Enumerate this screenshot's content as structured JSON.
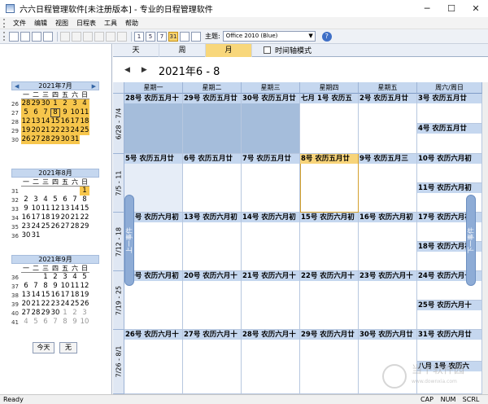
{
  "window": {
    "title": "六六日程管理软件[未注册版本] - 专业的日程管理软件",
    "minimize": "─",
    "maximize": "☐",
    "close": "✕"
  },
  "menu": [
    "文件",
    "编辑",
    "视图",
    "日程表",
    "工具",
    "帮助"
  ],
  "toolbar": {
    "buttons": [
      "new-icon",
      "open-icon",
      "save-icon",
      "print-icon",
      "undo-icon",
      "redo-icon",
      "cut-icon",
      "copy-icon",
      "paste-icon",
      "delete-icon",
      "day-view-icon",
      "workweek-view-icon",
      "week-view-icon",
      "month-view-icon",
      "calendar-icon",
      "options-icon"
    ],
    "view_labels": [
      "1",
      "5",
      "7",
      "31"
    ],
    "theme_label": "主题:",
    "theme_value": "Office 2010 (Blue)",
    "help": "?"
  },
  "left": {
    "dow": [
      "一",
      "二",
      "三",
      "四",
      "五",
      "六",
      "日"
    ],
    "months": [
      {
        "title": "2021年7月",
        "weeks": [
          {
            "wk": "26",
            "days": [
              "28",
              "29",
              "30",
              "1",
              "2",
              "3",
              "4"
            ]
          },
          {
            "wk": "27",
            "days": [
              "5",
              "6",
              "7",
              "8",
              "9",
              "10",
              "11"
            ]
          },
          {
            "wk": "28",
            "days": [
              "12",
              "13",
              "14",
              "15",
              "16",
              "17",
              "18"
            ]
          },
          {
            "wk": "29",
            "days": [
              "19",
              "20",
              "21",
              "22",
              "23",
              "24",
              "25"
            ]
          },
          {
            "wk": "30",
            "days": [
              "26",
              "27",
              "28",
              "29",
              "30",
              "31",
              ""
            ]
          }
        ]
      },
      {
        "title": "2021年8月",
        "weeks": [
          {
            "wk": "31",
            "days": [
              "",
              "",
              "",
              "",
              "",
              "",
              "1"
            ]
          },
          {
            "wk": "32",
            "days": [
              "2",
              "3",
              "4",
              "5",
              "6",
              "7",
              "8"
            ]
          },
          {
            "wk": "33",
            "days": [
              "9",
              "10",
              "11",
              "12",
              "13",
              "14",
              "15"
            ]
          },
          {
            "wk": "34",
            "days": [
              "16",
              "17",
              "18",
              "19",
              "20",
              "21",
              "22"
            ]
          },
          {
            "wk": "35",
            "days": [
              "23",
              "24",
              "25",
              "26",
              "27",
              "28",
              "29"
            ]
          },
          {
            "wk": "36",
            "days": [
              "30",
              "31",
              "",
              "",
              "",
              "",
              ""
            ]
          }
        ]
      },
      {
        "title": "2021年9月",
        "weeks": [
          {
            "wk": "36",
            "days": [
              "",
              "",
              "1",
              "2",
              "3",
              "4",
              "5"
            ]
          },
          {
            "wk": "37",
            "days": [
              "6",
              "7",
              "8",
              "9",
              "10",
              "11",
              "12"
            ]
          },
          {
            "wk": "38",
            "days": [
              "13",
              "14",
              "15",
              "16",
              "17",
              "18",
              "19"
            ]
          },
          {
            "wk": "39",
            "days": [
              "20",
              "21",
              "22",
              "23",
              "24",
              "25",
              "26"
            ]
          },
          {
            "wk": "40",
            "days": [
              "27",
              "28",
              "29",
              "30",
              "1",
              "2",
              "3"
            ]
          },
          {
            "wk": "41",
            "days": [
              "4",
              "5",
              "6",
              "7",
              "8",
              "9",
              "10"
            ]
          }
        ]
      }
    ],
    "today_label": "今天",
    "none_label": "无"
  },
  "right": {
    "tabs": [
      "天",
      "周",
      "月"
    ],
    "timeline_label": "时间轴模式",
    "nav_title": "2021年6 - 8",
    "days": [
      "星期一",
      "星期二",
      "星期三",
      "星期四",
      "星期五",
      "周六/周日"
    ],
    "prev_label": "上一事件",
    "next_label": "下一事件",
    "weeks": [
      {
        "label": "6/28 - 7/4",
        "cells": [
          "28号 农历五月十",
          "29号 农历五月廿",
          "30号 农历五月廿",
          "七月 1号 农历五",
          "2号 农历五月廿",
          "3号 农历五月廿"
        ],
        "weekend2": "4号 农历五月廿"
      },
      {
        "label": "7/5 - 11",
        "cells": [
          "5号 农历五月廿",
          "6号 农历五月廿",
          "7号 农历五月廿",
          "8号 农历五月廿",
          "9号 农历五月三",
          "10号 农历六月初"
        ],
        "weekend2": "11号 农历六月初"
      },
      {
        "label": "7/12 - 18",
        "cells": [
          "12号 农历六月初",
          "13号 农历六月初",
          "14号 农历六月初",
          "15号 农历六月初",
          "16号 农历六月初",
          "17号 农历六月初"
        ],
        "weekend2": "18号 农历六月初"
      },
      {
        "label": "7/19 - 25",
        "cells": [
          "19号 农历六月初",
          "20号 农历六月十",
          "21号 农历六月十",
          "22号 农历六月十",
          "23号 农历六月十",
          "24号 农历六月十"
        ],
        "weekend2": "25号 农历六月十"
      },
      {
        "label": "7/26 - 8/1",
        "cells": [
          "26号 农历六月十",
          "27号 农历六月十",
          "28号 农历六月十",
          "29号 农历六月廿",
          "30号 农历六月廿",
          "31号 农历六月廿"
        ],
        "weekend2": "八月 1号 农历六"
      }
    ]
  },
  "status": {
    "left": "Ready",
    "cap": "CAP",
    "num": "NUM",
    "scrl": "SCRL"
  },
  "watermark": {
    "text": "当下软件园",
    "sub": "www.downxia.com"
  }
}
